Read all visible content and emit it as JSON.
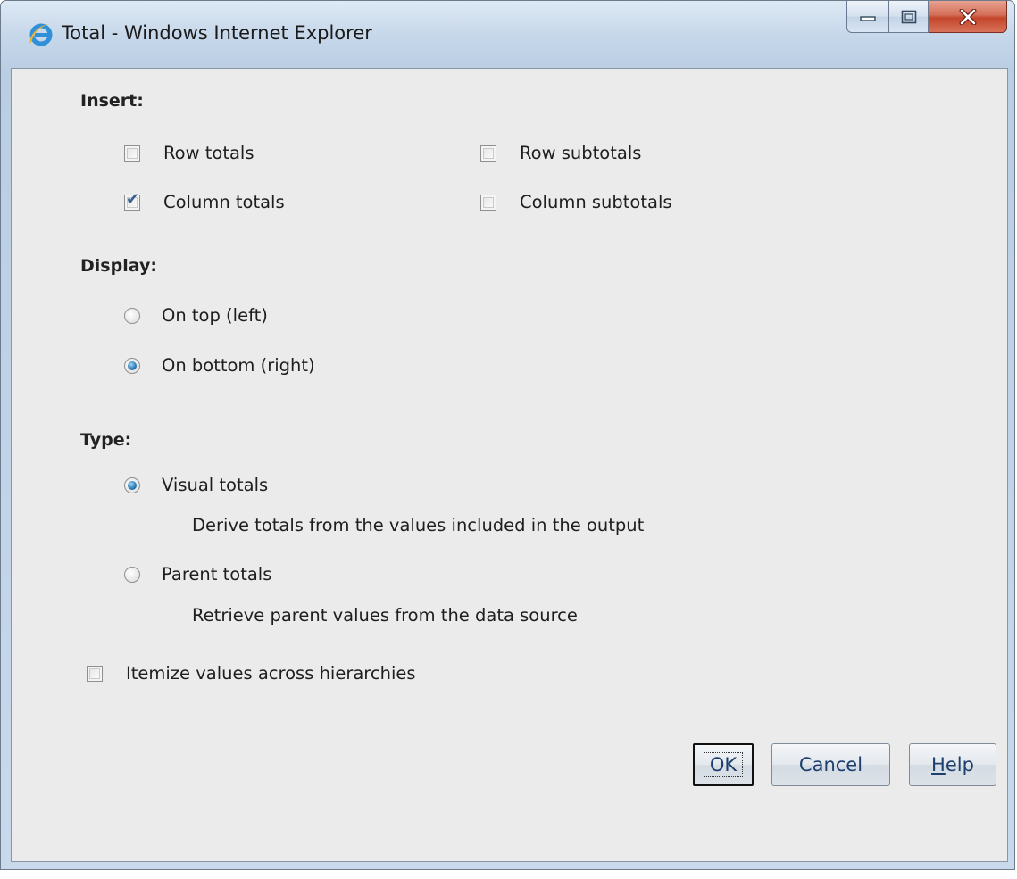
{
  "window": {
    "title": "Total - Windows Internet Explorer"
  },
  "insert": {
    "label": "Insert:",
    "row_totals": {
      "label": "Row totals",
      "checked": false
    },
    "row_subtotals": {
      "label": "Row subtotals",
      "checked": false
    },
    "column_totals": {
      "label": "Column totals",
      "checked": true
    },
    "column_subtotals": {
      "label": "Column subtotals",
      "checked": false
    }
  },
  "display": {
    "label": "Display:",
    "on_top": {
      "label": "On top (left)",
      "selected": false
    },
    "on_bottom": {
      "label": "On bottom (right)",
      "selected": true
    }
  },
  "type": {
    "label": "Type:",
    "visual": {
      "label": "Visual totals",
      "selected": true,
      "description": "Derive totals from the values included in the output"
    },
    "parent": {
      "label": "Parent totals",
      "selected": false,
      "description": "Retrieve parent values from the data source"
    }
  },
  "itemize": {
    "label": "Itemize values across hierarchies",
    "checked": false
  },
  "buttons": {
    "ok": "OK",
    "cancel": "Cancel",
    "help_first": "H",
    "help_rest": "elp"
  },
  "colors": {
    "accent": "#2d7db8",
    "close_button": "#c4452a",
    "dialog_background": "#ebebeb"
  },
  "icons": [
    "ie-icon",
    "minimize-icon",
    "maximize-icon",
    "close-icon",
    "checkmark-icon"
  ]
}
